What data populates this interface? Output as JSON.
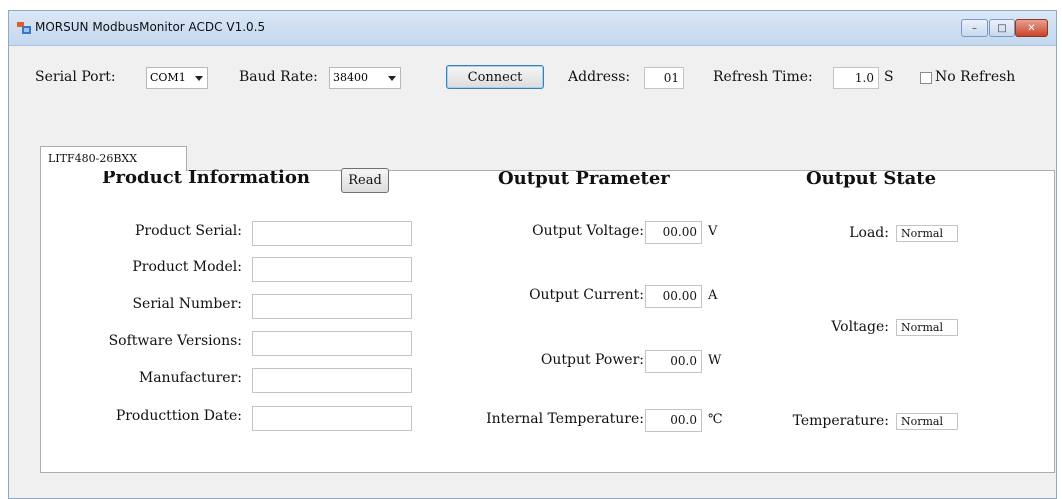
{
  "window": {
    "title": "MORSUN ModbusMonitor ACDC V1.0.5",
    "controls": {
      "minimize": "–",
      "maximize": "□",
      "close": "✕"
    }
  },
  "toolbar": {
    "serial_port_label": "Serial Port:",
    "serial_port_value": "COM1",
    "baud_rate_label": "Baud Rate:",
    "baud_rate_value": "38400",
    "connect_label": "Connect",
    "address_label": "Address:",
    "address_value": "01",
    "refresh_label": "Refresh Time:",
    "refresh_value": "1.0",
    "refresh_unit": "S",
    "no_refresh_label": "No Refresh"
  },
  "tab": {
    "label": "LITF480-26BXX"
  },
  "product": {
    "heading": "Product Information",
    "read_label": "Read",
    "fields": [
      {
        "label": "Product Serial:",
        "value": ""
      },
      {
        "label": "Product Model:",
        "value": ""
      },
      {
        "label": "Serial Number:",
        "value": ""
      },
      {
        "label": "Software Versions:",
        "value": ""
      },
      {
        "label": "Manufacturer:",
        "value": ""
      },
      {
        "label": "Producttion Date:",
        "value": ""
      }
    ]
  },
  "output": {
    "heading": "Output Prameter",
    "fields": [
      {
        "label": "Output Voltage:",
        "value": "00.00",
        "unit": "V"
      },
      {
        "label": "Output Current:",
        "value": "00.00",
        "unit": "A"
      },
      {
        "label": "Output Power:",
        "value": "00.0",
        "unit": "W"
      },
      {
        "label": "Internal Temperature:",
        "value": "00.0",
        "unit": "℃"
      }
    ]
  },
  "state": {
    "heading": "Output State",
    "fields": [
      {
        "label": "Load:",
        "value": "Normal"
      },
      {
        "label": "Voltage:",
        "value": "Normal"
      },
      {
        "label": "Temperature:",
        "value": "Normal"
      }
    ]
  }
}
